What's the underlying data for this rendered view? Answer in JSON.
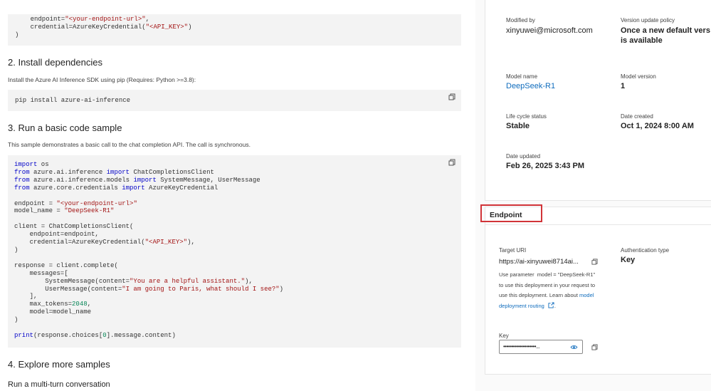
{
  "left": {
    "code_top": [
      "    endpoint=\"<your-endpoint-url>\",",
      "    credential=AzureKeyCredential(\"<API_KEY>\")",
      ")"
    ],
    "install_heading": "2. Install dependencies",
    "install_desc": "Install the Azure AI Inference SDK using pip (Requires: Python >=3.8):",
    "install_cmd": "pip install azure-ai-inference",
    "run_heading": "3. Run a basic code sample",
    "run_desc": "This sample demonstrates a basic call to the chat completion API. The call is synchronous.",
    "explore_heading": "4. Explore more samples",
    "multiturn_heading": "Run a multi-turn conversation",
    "icons": [
      "copy-icon",
      "copy-icon"
    ]
  },
  "details": {
    "modified_by_label": "Modified by",
    "modified_by_value": "xinyuwei@microsoft.com",
    "version_policy_label": "Version update policy",
    "version_policy_value_1": "Once a new default vers",
    "version_policy_value_2": "is available",
    "model_name_label": "Model name",
    "model_name_value": "DeepSeek-R1",
    "model_version_label": "Model version",
    "model_version_value": "1",
    "lifecycle_label": "Life cycle status",
    "lifecycle_value": "Stable",
    "date_created_label": "Date created",
    "date_created_value": "Oct 1, 2024 8:00 AM",
    "date_updated_label": "Date updated",
    "date_updated_value": "Feb 26, 2025 3:43 PM"
  },
  "endpoint": {
    "title": "Endpoint",
    "target_uri_label": "Target URI",
    "target_uri_value": "https://ai-xinyuwei8714ai...",
    "auth_type_label": "Authentication type",
    "auth_type_value": "Key",
    "note_1": "Use parameter  model = \"DeepSeek-R1\"",
    "note_2": "to use this deployment in your request to",
    "note_3a": "use this deployment. Learn about ",
    "note_3b": "model",
    "note_4": "deployment routing",
    "key_label": "Key",
    "key_value": "••••••••••••••••••••...",
    "icons": [
      "copy-icon",
      "external-link-icon",
      "eye-icon",
      "copy-icon"
    ],
    "highlight_color": "#d13438"
  }
}
